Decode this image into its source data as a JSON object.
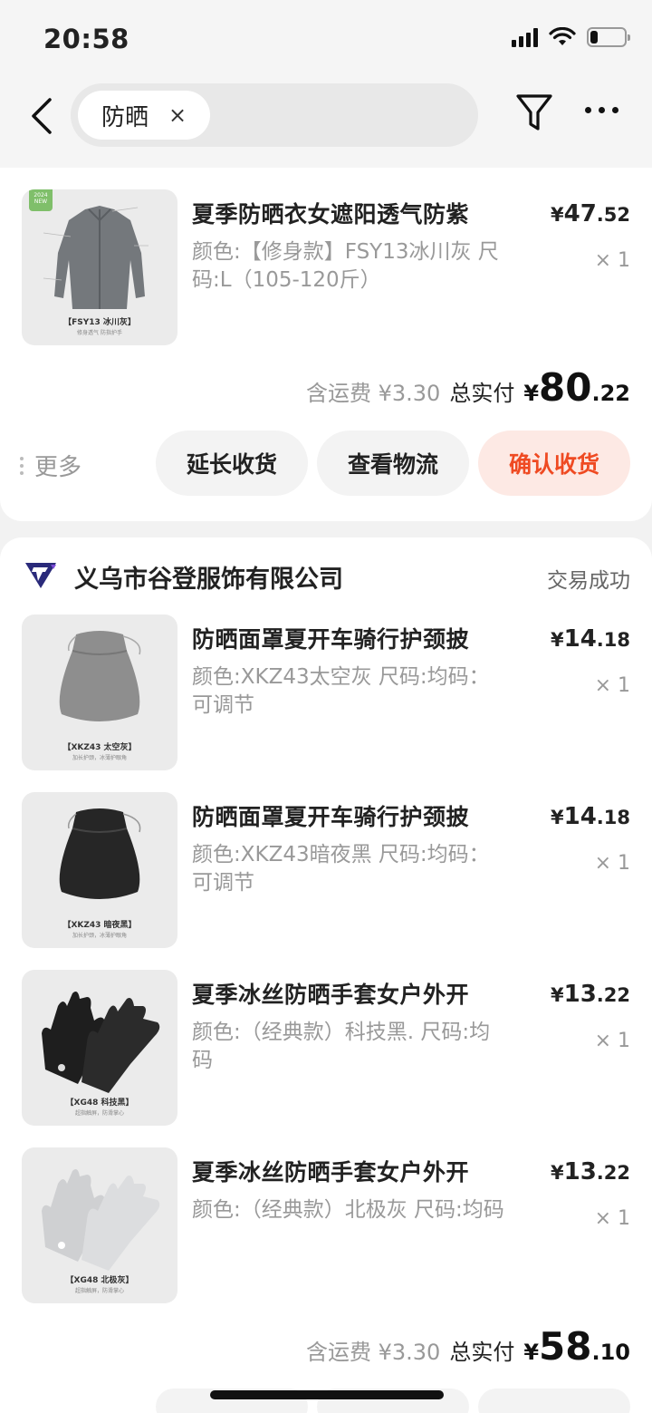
{
  "status_bar": {
    "time": "20:58",
    "battery_level": 0.22
  },
  "nav": {
    "search_chip": "防晒",
    "chip_close": "×"
  },
  "order1": {
    "items": [
      {
        "title": "夏季防晒衣女遮阳透气防紫",
        "spec": "颜色:【修身款】FSY13冰川灰 尺码:L（105-120斤）",
        "price_cur": "¥",
        "price_int": "47",
        "price_dec": ".52",
        "qty": "× 1",
        "thumb_caption": "【FSY13 冰川灰】",
        "thumb_sub": "修身透气 防指护手",
        "thumb_badge": "2024 NEW"
      }
    ],
    "freight": "含运费 ¥3.30",
    "paid_label": "总实付",
    "paid_cur": "¥",
    "paid_int": "80",
    "paid_dec": ".22",
    "more_label": "更多",
    "actions": [
      "延长收货",
      "查看物流",
      "确认收货"
    ]
  },
  "order2": {
    "shop_name": "义乌市谷登服饰有限公司",
    "status": "交易成功",
    "items": [
      {
        "title": "防晒面罩夏开车骑行护颈披",
        "spec": "颜色:XKZ43太空灰 尺码:均码：可调节",
        "price_cur": "¥",
        "price_int": "14",
        "price_dec": ".18",
        "qty": "× 1",
        "thumb_caption": "【XKZ43 太空灰】",
        "thumb_sub": "加长护颈，冰薄护眼角"
      },
      {
        "title": "防晒面罩夏开车骑行护颈披",
        "spec": "颜色:XKZ43暗夜黑 尺码:均码：可调节",
        "price_cur": "¥",
        "price_int": "14",
        "price_dec": ".18",
        "qty": "× 1",
        "thumb_caption": "【XKZ43 暗夜黑】",
        "thumb_sub": "加长护颈，冰薄护眼角"
      },
      {
        "title": "夏季冰丝防晒手套女户外开",
        "spec": "颜色:（经典款）科技黑. 尺码:均码",
        "price_cur": "¥",
        "price_int": "13",
        "price_dec": ".22",
        "qty": "× 1",
        "thumb_caption": "【XG48 科技黑】",
        "thumb_sub": "超指触屏，防滑掌心"
      },
      {
        "title": "夏季冰丝防晒手套女户外开",
        "spec": "颜色:（经典款）北极灰 尺码:均码",
        "price_cur": "¥",
        "price_int": "13",
        "price_dec": ".22",
        "qty": "× 1",
        "thumb_caption": "【XG48 北极灰】",
        "thumb_sub": "超指触屏，防滑掌心"
      }
    ],
    "freight": "含运费 ¥3.30",
    "paid_label": "总实付",
    "paid_cur": "¥",
    "paid_int": "58",
    "paid_dec": ".10"
  },
  "colors": {
    "accent": "#ef4a22",
    "accent_bg": "#fde9e4",
    "shop_logo": "#2a2a7a"
  }
}
